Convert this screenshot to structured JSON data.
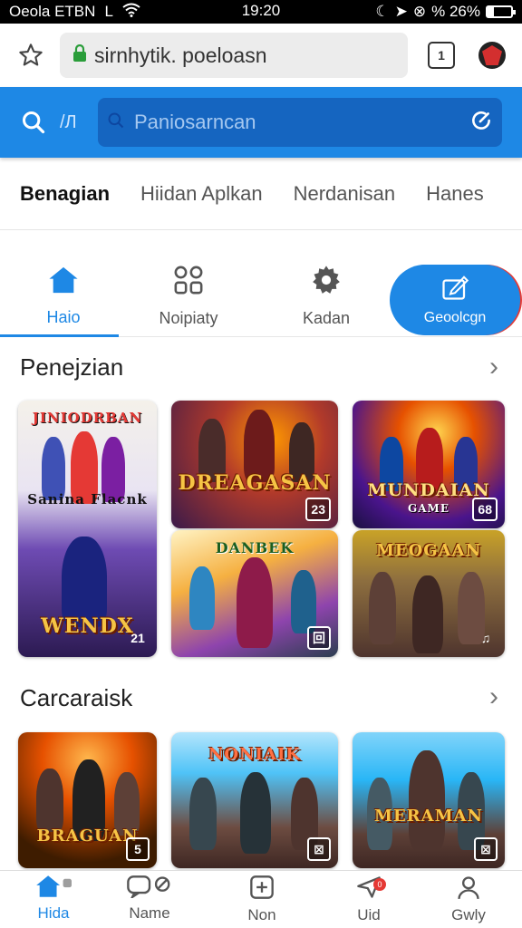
{
  "status_bar": {
    "carrier": "Oeola ETBN",
    "network": "L",
    "time": "19:20",
    "battery": "% 26%",
    "battery_level": 0.26
  },
  "browser": {
    "url": "sirnhytik. poeloasn",
    "tab_count": "1"
  },
  "search": {
    "secondary_icon_label": "/Л",
    "placeholder": "Paniosarncan"
  },
  "categories": [
    "Benagian",
    "Hiidan Aplkan",
    "Nerdanisan",
    "Hanes"
  ],
  "tabs": [
    "Haio",
    "Noipiaty",
    "Kadan",
    "Geoolcgn"
  ],
  "sections": [
    {
      "title": "Penejzian",
      "cards": [
        {
          "title": "JINIODRBAN",
          "subtitle": "Sanina Flacnk",
          "title2": "WENDX",
          "badge": "21"
        },
        {
          "title": "DREAGASAN",
          "subtitle": "",
          "badge": "23"
        },
        {
          "title": "MUNDAIAN",
          "subtitle": "GAME",
          "badge": "68"
        },
        {
          "title": "DANBEK",
          "subtitle": "",
          "badge": "回"
        },
        {
          "title": "MEOGAAN",
          "subtitle": "",
          "badge": "♫"
        }
      ]
    },
    {
      "title": "Carcaraisk",
      "cards": [
        {
          "title": "BRAGUAN",
          "badge": "5"
        },
        {
          "title": "NONIAIK",
          "badge": "⊠"
        },
        {
          "title": "MERAMAN",
          "badge": "⊠"
        }
      ]
    }
  ],
  "bottom_nav": [
    "Hida",
    "Name",
    "Non",
    "Uid",
    "Gwly"
  ],
  "notification_count": "0",
  "colors": {
    "accent": "#1e88e5",
    "accent_dark": "#1565c0",
    "notification": "#e53935"
  }
}
